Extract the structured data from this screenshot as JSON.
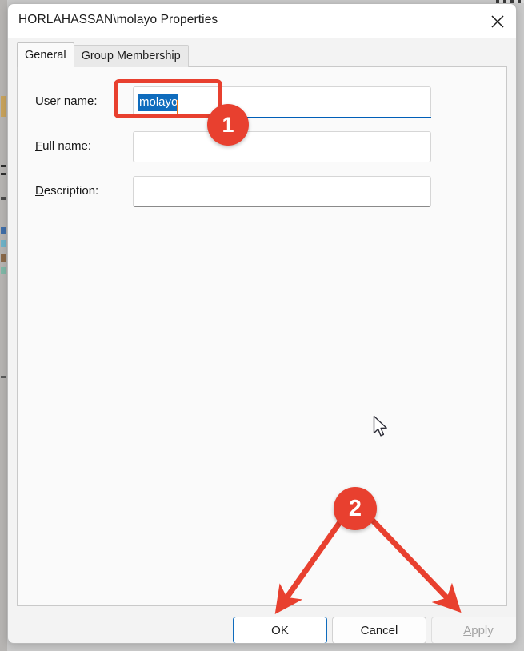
{
  "window": {
    "title": "HORLAHASSAN\\molayo Properties",
    "close_icon": "close-icon"
  },
  "tabs": [
    {
      "label": "General",
      "selected": true
    },
    {
      "label": "Group Membership",
      "selected": false
    }
  ],
  "form": {
    "fields": [
      {
        "label_prefix": "U",
        "label_rest": "ser name:",
        "value": "molayo",
        "placeholder": "",
        "focused": true,
        "selected_text": "molayo"
      },
      {
        "label_prefix": "F",
        "label_rest": "ull name:",
        "value": "",
        "placeholder": "",
        "focused": false
      },
      {
        "label_prefix": "D",
        "label_rest": "escription:",
        "value": "",
        "placeholder": "",
        "focused": false
      }
    ]
  },
  "footer": {
    "ok_label": "OK",
    "cancel_label": "Cancel",
    "apply_prefix": "A",
    "apply_rest": "pply",
    "apply_disabled": true
  },
  "annotations": {
    "badge_1": "1",
    "badge_2": "2",
    "highlight_color": "#e8402f",
    "arrows": [
      {
        "from": "badge-2",
        "to": "ok-button"
      },
      {
        "from": "badge-2",
        "to": "apply-button"
      }
    ]
  },
  "colors": {
    "accent": "#0f6cbd",
    "focus_underline": "#005fb8",
    "annotation_red": "#e8402f",
    "dialog_bg": "#f3f3f3",
    "panel_bg": "#fafafa",
    "titlebar_bg": "#ffffff"
  }
}
